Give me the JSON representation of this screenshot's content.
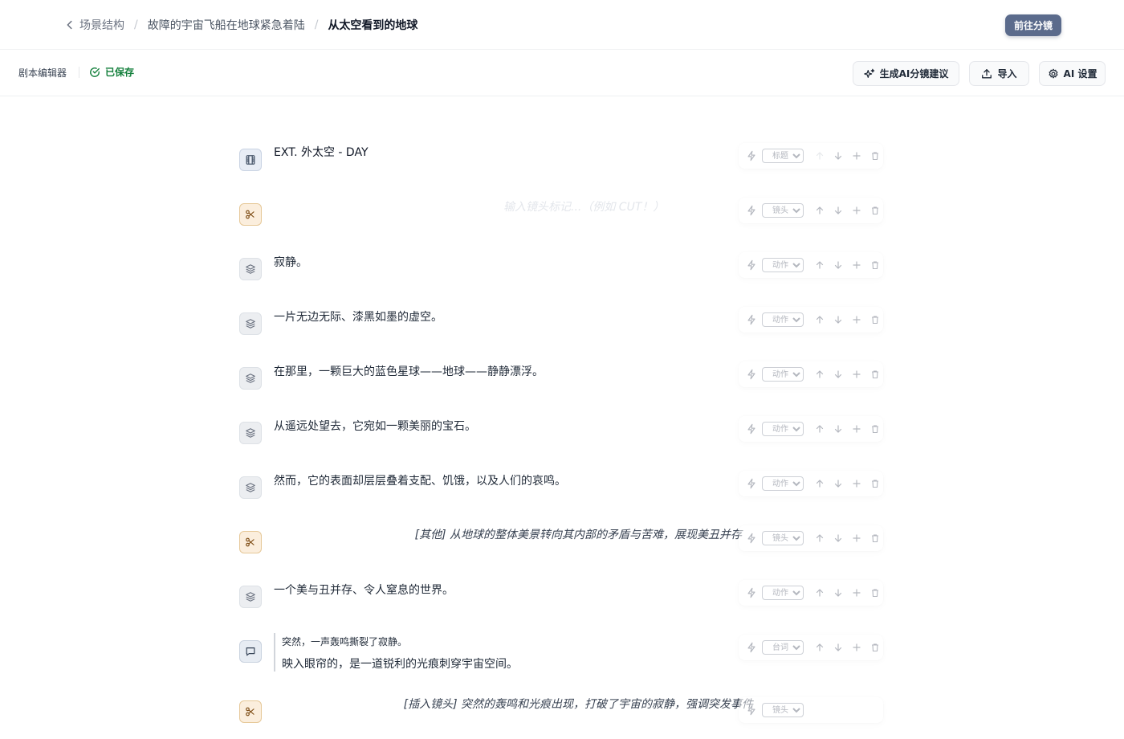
{
  "breadcrumb": {
    "back": "场景结构",
    "separator": "/",
    "parent": "故障的宇宙飞船在地球紧急着陆",
    "current": "从太空看到的地球"
  },
  "header": {
    "primary_button": "前往分镜"
  },
  "toolbar": {
    "editor_label": "剧本编辑器",
    "saved_label": "已保存",
    "ai_button": "生成AI分镜建议",
    "import_button": "导入",
    "settings_button": "AI 设置"
  },
  "rows": [
    {
      "type": "heading",
      "text": "EXT. 外太空 - DAY",
      "select": "标题"
    },
    {
      "type": "cut",
      "placeholder": "输入镜头标记...（例如 CUT！）",
      "select": "镜头"
    },
    {
      "type": "action",
      "text": "寂静。",
      "select": "动作"
    },
    {
      "type": "action",
      "text": "一片无边无际、漆黑如墨的虚空。",
      "select": "动作"
    },
    {
      "type": "action",
      "text": "在那里，一颗巨大的蓝色星球——地球——静静漂浮。",
      "select": "动作"
    },
    {
      "type": "action",
      "text": "从遥远处望去，它宛如一颗美丽的宝石。",
      "select": "动作"
    },
    {
      "type": "action",
      "text": "然而，它的表面却层层叠着支配、饥饿，以及人们的哀鸣。",
      "select": "动作"
    },
    {
      "type": "cut",
      "text": "[其他] 从地球的整体美景转向其内部的矛盾与苦难，展现美丑并存",
      "select": "镜头"
    },
    {
      "type": "action",
      "text": "一个美与丑并存、令人窒息的世界。",
      "select": "动作"
    },
    {
      "type": "dialog",
      "line1": "突然，一声轰鸣撕裂了寂静。",
      "line2": "映入眼帘的，是一道锐利的光痕刺穿宇宙空间。",
      "select": "台词"
    },
    {
      "type": "cut",
      "text": "[插入镜头] 突然的轰鸣和光痕出现，打破了宇宙的寂静，强调突发事件",
      "select": "镜头"
    }
  ],
  "type_options": [
    "标题",
    "镜头",
    "动作",
    "台词"
  ]
}
